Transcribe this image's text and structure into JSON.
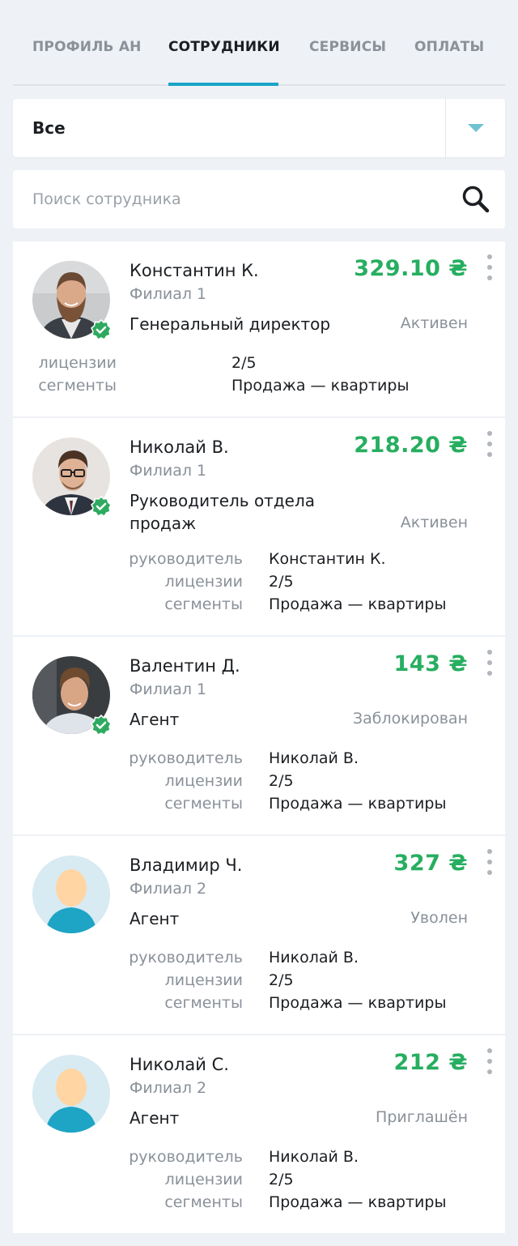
{
  "tabs": [
    {
      "label": "ПРОФИЛЬ АН"
    },
    {
      "label": "СОТРУДНИКИ"
    },
    {
      "label": "СЕРВИСЫ"
    },
    {
      "label": "ОПЛАТЫ"
    }
  ],
  "filter": {
    "selected": "Все"
  },
  "search": {
    "placeholder": "Поиск сотрудника"
  },
  "colors": {
    "accent": "#1aa3c8",
    "amount": "#27ae60",
    "verified": "#2eaa60",
    "avatar_bg": "#d8eaf2",
    "avatar_body": "#1ea4c5",
    "avatar_head": "#ffd5a3"
  },
  "labels": {
    "manager": "руководитель",
    "licenses": "лицензии",
    "segments": "сегменты"
  },
  "employees": [
    {
      "name": "Константин К.",
      "branch": "Филиал 1",
      "role": "Генеральный директор",
      "status": "Активен",
      "amount": "329.10 ₴",
      "licenses": "2/5",
      "segments": "Продажа — квартиры",
      "avatar": "photo-bearded-man",
      "verified": true
    },
    {
      "name": "Николай В.",
      "branch": "Филиал 1",
      "role": "Руководитель отдела продаж",
      "status": "Активен",
      "amount": "218.20 ₴",
      "manager": "Константин К.",
      "licenses": "2/5",
      "segments": "Продажа — квартиры",
      "avatar": "photo-man-glasses",
      "verified": true
    },
    {
      "name": "Валентин Д.",
      "branch": "Филиал 1",
      "role": "Агент",
      "status": "Заблокирован",
      "amount": "143 ₴",
      "manager": "Николай В.",
      "licenses": "2/5",
      "segments": "Продажа — квартиры",
      "avatar": "photo-young-man",
      "verified": true
    },
    {
      "name": "Владимир Ч.",
      "branch": "Филиал 2",
      "role": "Агент",
      "status": "Уволен",
      "amount": "327 ₴",
      "manager": "Николай В.",
      "licenses": "2/5",
      "segments": "Продажа — квартиры",
      "avatar": "placeholder-avatar",
      "verified": false
    },
    {
      "name": "Николай С.",
      "branch": "Филиал 2",
      "role": "Агент",
      "status": "Приглашён",
      "amount": "212 ₴",
      "manager": "Николай В.",
      "licenses": "2/5",
      "segments": "Продажа — квартиры",
      "avatar": "placeholder-avatar",
      "verified": false
    }
  ]
}
